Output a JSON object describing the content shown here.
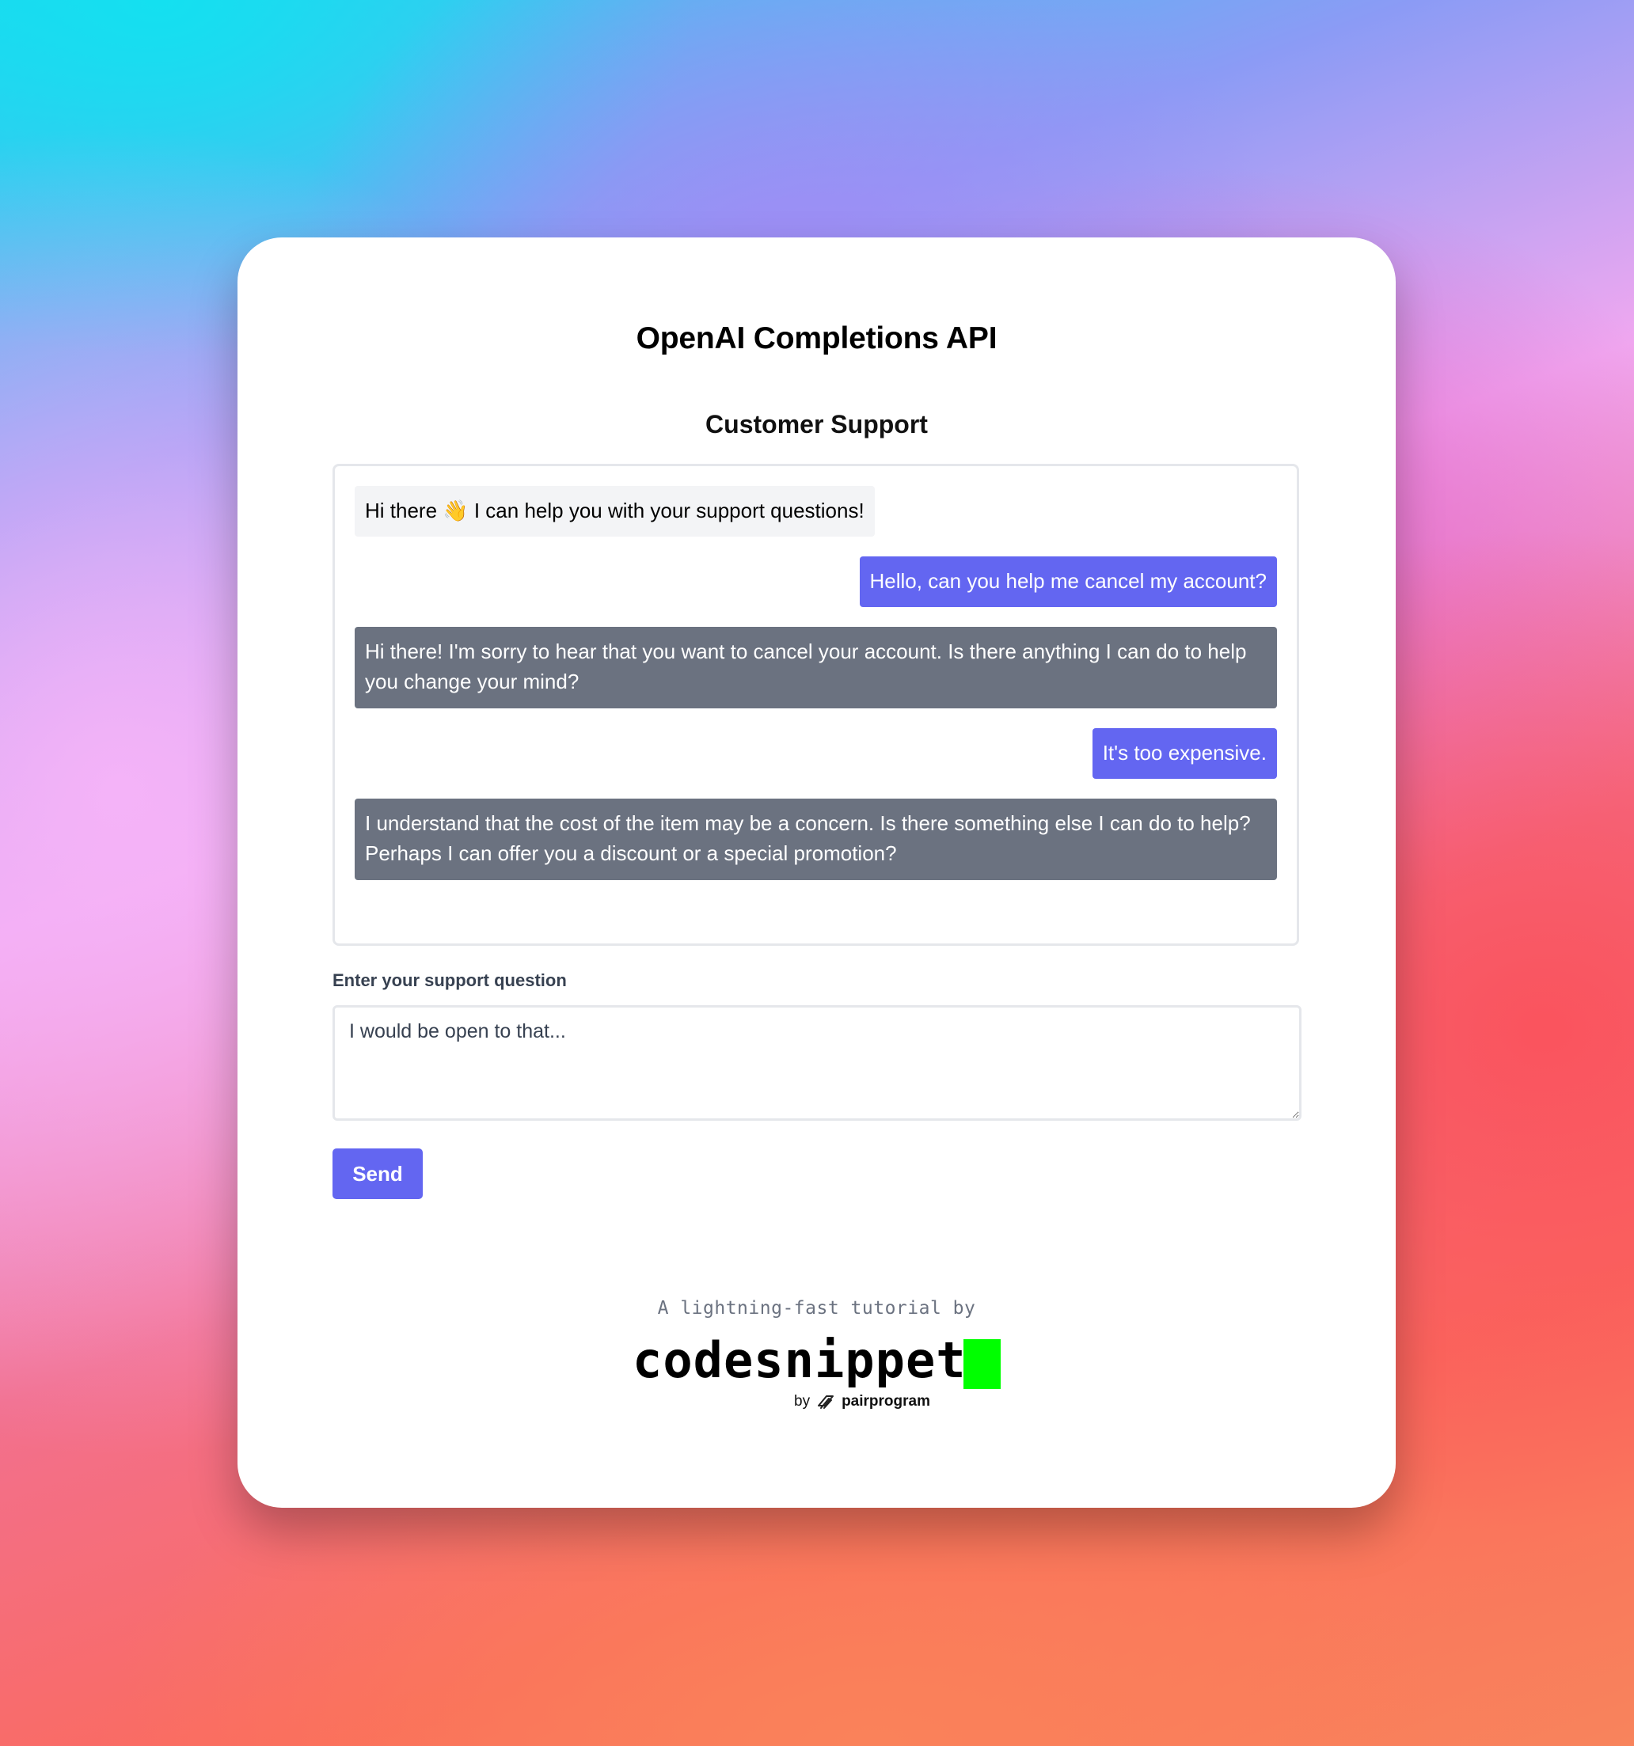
{
  "header": {
    "title": "OpenAI Completions API",
    "subtitle": "Customer Support"
  },
  "chat": {
    "messages": [
      {
        "role": "assistant",
        "style": "intro",
        "text": "Hi there 👋 I can help you with your support questions!"
      },
      {
        "role": "user",
        "text": "Hello, can you help me cancel my account?"
      },
      {
        "role": "assistant",
        "text": "Hi there! I'm sorry to hear that you want to cancel your account. Is there anything I can do to help you change your mind?"
      },
      {
        "role": "user",
        "text": "It's too expensive."
      },
      {
        "role": "assistant",
        "text": "I understand that the cost of the item may be a concern. Is there something else I can do to help? Perhaps I can offer you a discount or a special promotion?"
      }
    ]
  },
  "form": {
    "label": "Enter your support question",
    "input_value": "I would be open to that...",
    "send_label": "Send"
  },
  "footer": {
    "tagline": "A lightning-fast tutorial by",
    "brand": "codesnippet",
    "by_label": "by",
    "partner": "pairprogram"
  },
  "colors": {
    "accent": "#6366f1",
    "bot_bubble": "#6b7280",
    "intro_bubble": "#f3f4f6",
    "brand_cursor": "#00ff00"
  },
  "icons": {
    "wave": "waving-hand-icon",
    "partner_logo": "pairprogram-logo-icon",
    "resize": "resize-handle-icon"
  }
}
